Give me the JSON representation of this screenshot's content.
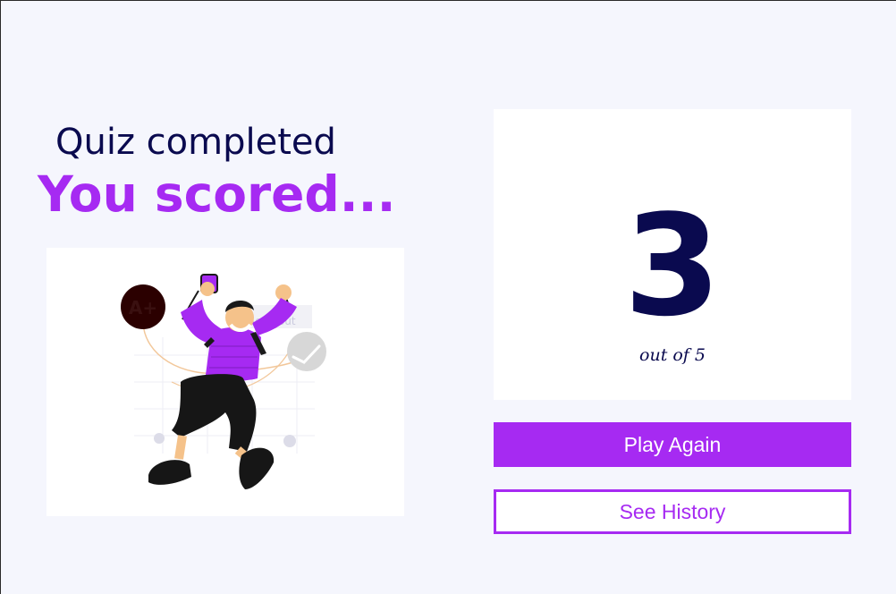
{
  "quiz": {
    "title": "Quiz completed",
    "subtitle": "You scored...",
    "score": "3",
    "total_text": "out of 5"
  },
  "illustration": {
    "badge_text": "A+",
    "watermark_text": "Scoreout"
  },
  "actions": {
    "play_again_label": "Play Again",
    "see_history_label": "See History"
  },
  "colors": {
    "background": "#f5f6fd",
    "accent": "#a62af2",
    "dark_text": "#0a0a4f",
    "card": "#ffffff"
  }
}
